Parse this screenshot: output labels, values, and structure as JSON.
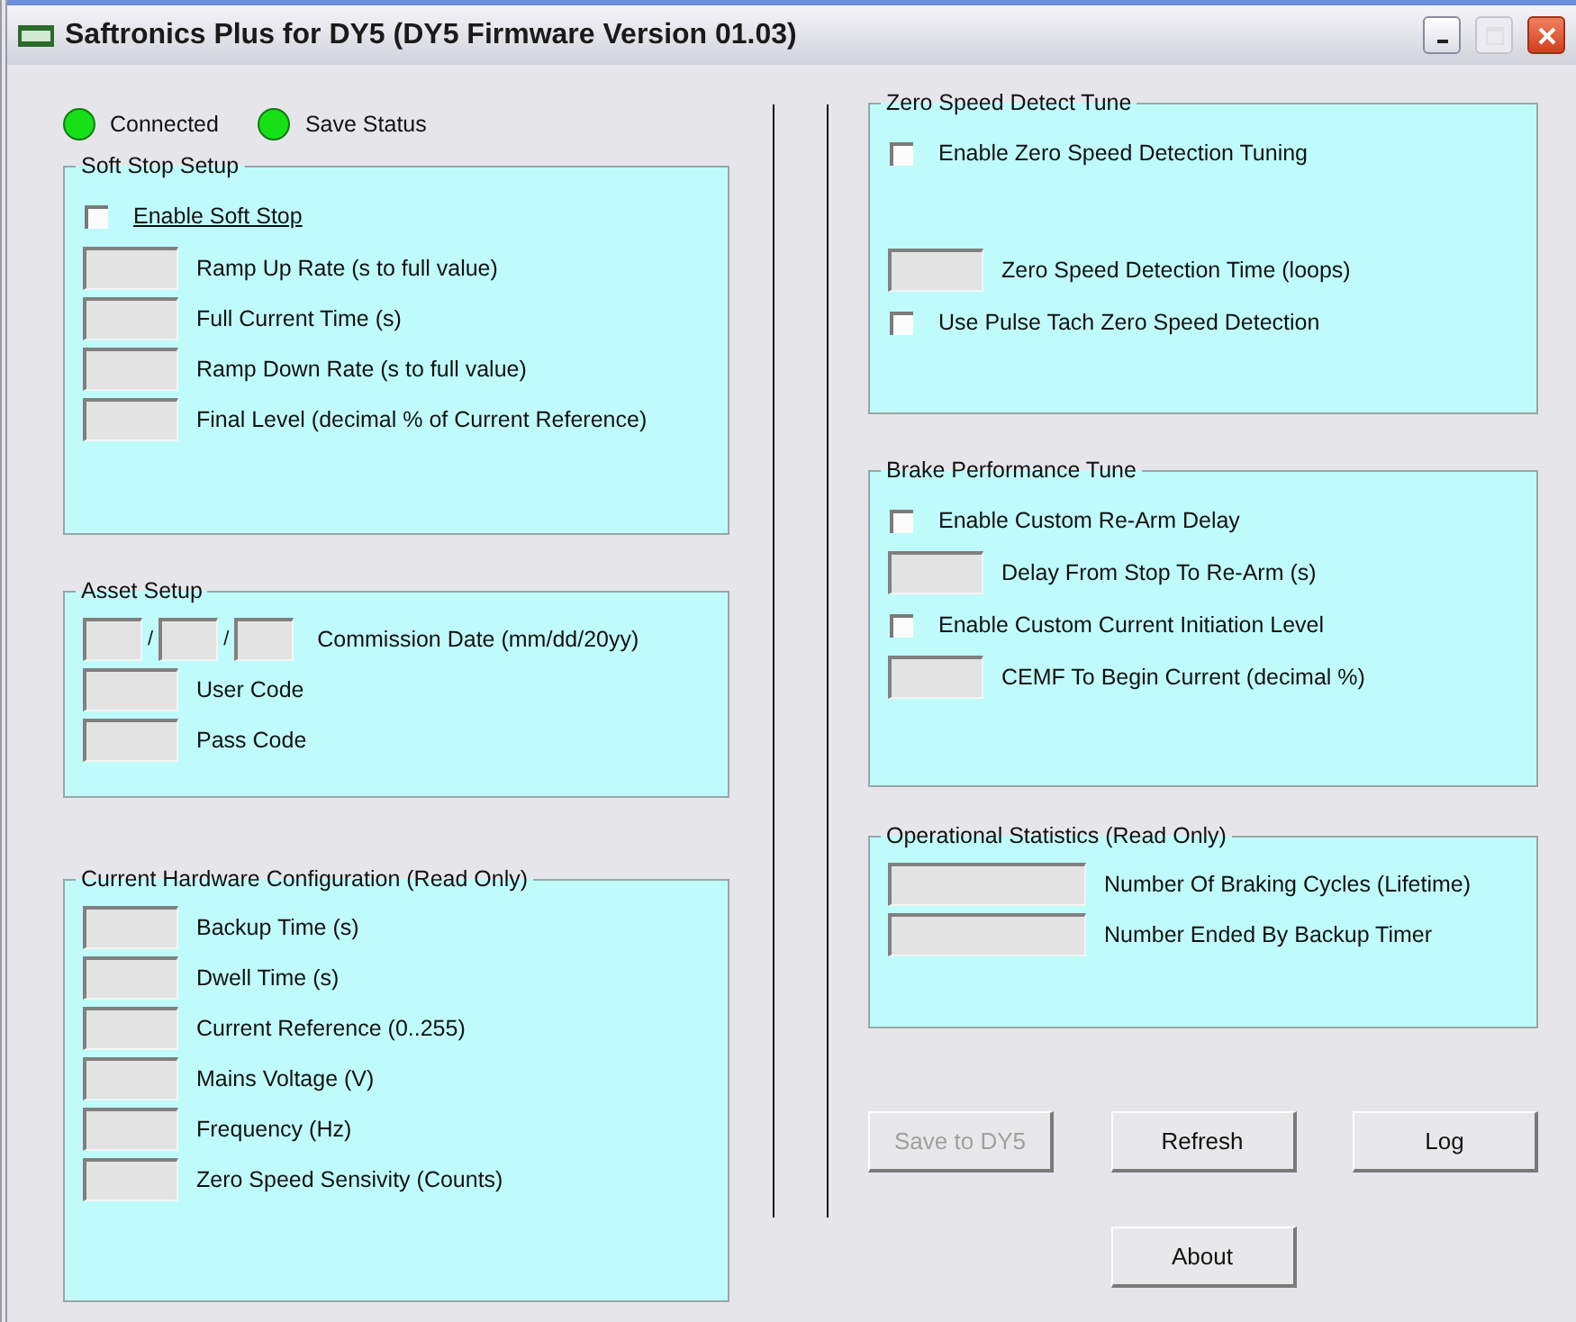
{
  "window": {
    "title": "Saftronics Plus for DY5  (DY5 Firmware Version 01.03)",
    "controls": [
      {
        "kind": "minimize",
        "disabled": false
      },
      {
        "kind": "maximize",
        "disabled": true
      },
      {
        "kind": "close",
        "disabled": false
      }
    ]
  },
  "indicators": [
    {
      "label": "Connected",
      "on": true
    },
    {
      "label": "Save Status",
      "on": true
    }
  ],
  "left_groups": [
    {
      "title": "Soft Stop Setup",
      "rows": [
        {
          "kind": "checkbox",
          "label": "Enable Soft Stop",
          "checked": false,
          "underline": true
        },
        {
          "kind": "field",
          "label": "Ramp Up Rate (s to full value)"
        },
        {
          "kind": "field",
          "label": "Full Current Time (s)"
        },
        {
          "kind": "field",
          "label": "Ramp Down Rate (s to full value)"
        },
        {
          "kind": "field",
          "label": "Final Level (decimal % of Current Reference)"
        }
      ]
    },
    {
      "title": "Asset Setup",
      "rows": [
        {
          "kind": "date",
          "label": "Commission Date (mm/dd/20yy)",
          "separators": [
            "/",
            "/"
          ]
        },
        {
          "kind": "field",
          "label": "User Code"
        },
        {
          "kind": "field",
          "label": "Pass Code"
        }
      ]
    },
    {
      "title": "Current Hardware Configuration (Read Only)",
      "rows": [
        {
          "kind": "field",
          "label": "Backup Time (s)"
        },
        {
          "kind": "field",
          "label": "Dwell Time (s)"
        },
        {
          "kind": "field",
          "label": "Current Reference (0..255)"
        },
        {
          "kind": "field",
          "label": "Mains Voltage (V)"
        },
        {
          "kind": "field",
          "label": "Frequency (Hz)"
        },
        {
          "kind": "field",
          "label": "Zero Speed Sensivity (Counts)"
        }
      ]
    }
  ],
  "right_groups": [
    {
      "title": "Zero Speed Detect Tune",
      "rows": [
        {
          "kind": "checkbox",
          "label": "Enable Zero Speed Detection Tuning",
          "checked": false
        },
        {
          "kind": "field",
          "label": "Zero Speed Detection Time (loops)"
        },
        {
          "kind": "checkbox",
          "label": "Use Pulse Tach Zero Speed Detection",
          "checked": false
        }
      ]
    },
    {
      "title": "Brake Performance Tune",
      "rows": [
        {
          "kind": "checkbox",
          "label": "Enable Custom Re-Arm Delay",
          "checked": false
        },
        {
          "kind": "field",
          "label": "Delay From Stop To Re-Arm (s)"
        },
        {
          "kind": "checkbox",
          "label": "Enable Custom Current Initiation Level",
          "checked": false
        },
        {
          "kind": "field",
          "label": "CEMF To Begin Current (decimal %)"
        }
      ]
    },
    {
      "title": "Operational Statistics (Read Only)",
      "rows": [
        {
          "kind": "wide-field",
          "label": "Number Of Braking Cycles (Lifetime)"
        },
        {
          "kind": "wide-field",
          "label": "Number Ended By Backup Timer"
        }
      ]
    }
  ],
  "buttons": [
    {
      "label": "Save to DY5",
      "disabled": true
    },
    {
      "label": "Refresh",
      "disabled": false
    },
    {
      "label": "Log",
      "disabled": false
    },
    {
      "label": "About",
      "disabled": false
    }
  ]
}
